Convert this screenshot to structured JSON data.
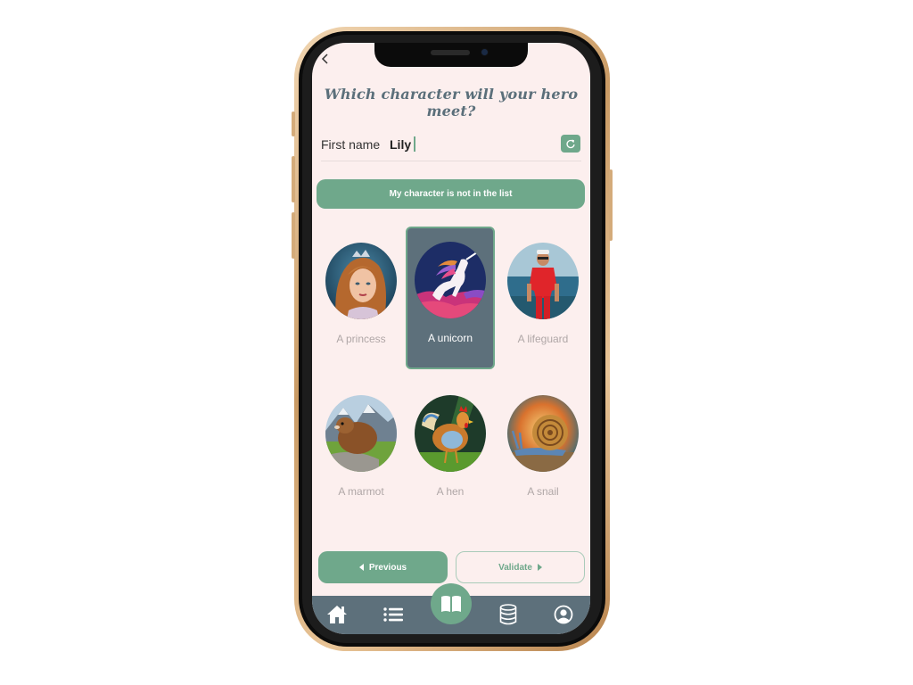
{
  "header": {
    "back_icon": "chevron-left-icon",
    "title": "Which character will your hero meet?"
  },
  "first_name": {
    "label": "First name",
    "value": "Lily",
    "refresh_icon": "refresh-icon"
  },
  "not_in_list_label": "My character is not in the list",
  "characters": [
    {
      "label": "A princess",
      "selected": false
    },
    {
      "label": "A unicorn",
      "selected": true
    },
    {
      "label": "A lifeguard",
      "selected": false
    },
    {
      "label": "A marmot",
      "selected": false
    },
    {
      "label": "A hen",
      "selected": false
    },
    {
      "label": "A snail",
      "selected": false
    }
  ],
  "footer": {
    "previous_label": "Previous",
    "validate_label": "Validate"
  },
  "tabbar": {
    "items": [
      "home-icon",
      "list-icon",
      "book-icon",
      "database-icon",
      "user-circle-icon"
    ],
    "active": "book-icon"
  },
  "colors": {
    "accent": "#6fa88b",
    "selected_bg": "#5d707b",
    "screen_bg": "#fcefee",
    "title": "#5b6f7a"
  }
}
